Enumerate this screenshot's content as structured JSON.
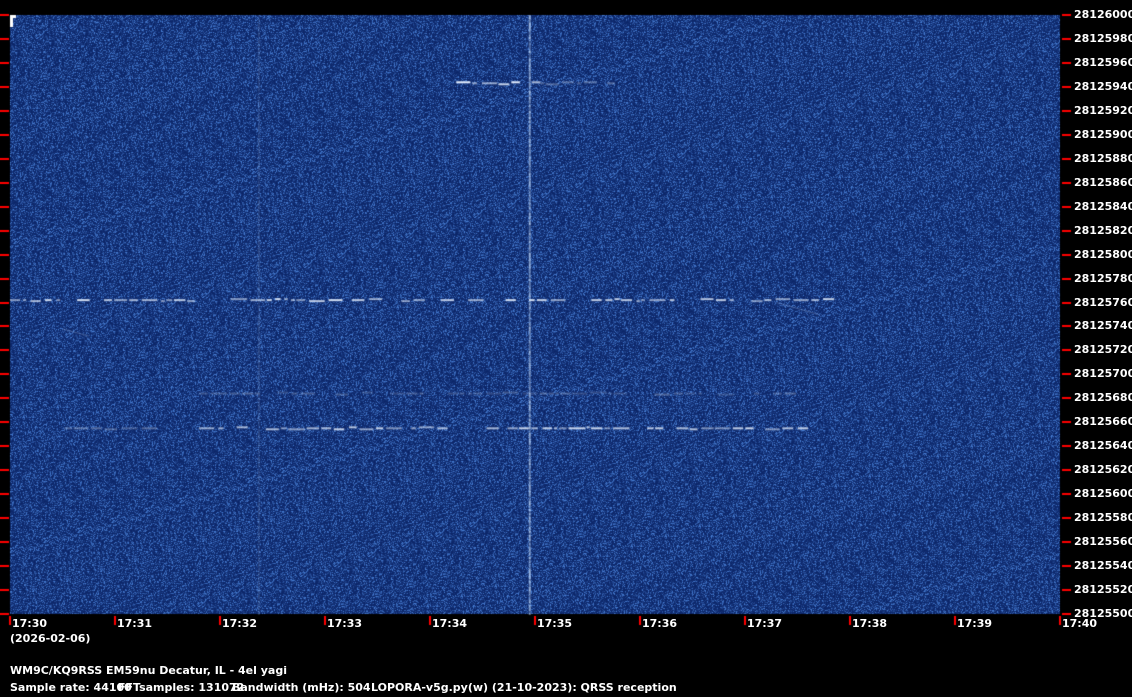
{
  "colors": {
    "background": "#000000",
    "waterfall_base": "#0d2a6e",
    "tick_marks": "#ff0000",
    "signal": "#e6f0ff",
    "text": "#ffffff"
  },
  "chart_data": {
    "type": "heatmap",
    "title": "",
    "xlabel": "",
    "ylabel": "",
    "frequency_axis_hz": {
      "range": [
        28125500,
        28126000
      ],
      "tick_labels": [
        "28126000",
        "28125980",
        "28125960",
        "28125940",
        "28125920",
        "28125900",
        "28125880",
        "28125860",
        "28125840",
        "28125820",
        "28125800",
        "28125780",
        "28125760",
        "28125740",
        "28125720",
        "28125700",
        "28125680",
        "28125660",
        "28125640",
        "28125620",
        "28125600",
        "28125580",
        "28125560",
        "28125540",
        "28125520",
        "28125500"
      ]
    },
    "time_axis": {
      "range_minutes": [
        1050,
        1060
      ],
      "tick_labels": [
        "17:30",
        "17:31",
        "17:32",
        "17:33",
        "17:34",
        "17:35",
        "17:36",
        "17:37",
        "17:38",
        "17:39",
        "17:40"
      ],
      "date": "(2026-02-06)"
    },
    "signals": [
      {
        "kind": "horizontal_trace",
        "freq_hz": 28125762,
        "t_start_min": 1050.0,
        "t_end_min": 1057.85,
        "intensity": 0.9
      },
      {
        "kind": "horizontal_trace",
        "freq_hz": 28125655,
        "t_start_min": 1051.8,
        "t_end_min": 1057.6,
        "intensity": 0.85
      },
      {
        "kind": "horizontal_trace",
        "freq_hz": 28125655,
        "t_start_min": 1050.4,
        "t_end_min": 1051.4,
        "intensity": 0.35
      },
      {
        "kind": "horizontal_trace",
        "freq_hz": 28125684,
        "t_start_min": 1051.8,
        "t_end_min": 1057.5,
        "intensity": 0.3
      },
      {
        "kind": "horizontal_trace",
        "freq_hz": 28125943,
        "t_start_min": 1054.25,
        "t_end_min": 1055.05,
        "intensity": 1.0
      },
      {
        "kind": "horizontal_trace",
        "freq_hz": 28125943,
        "t_start_min": 1055.05,
        "t_end_min": 1055.8,
        "intensity": 0.4
      },
      {
        "kind": "vertical_line",
        "t_min": 1054.95,
        "freq_start_hz": 28125500,
        "freq_end_hz": 28126000,
        "intensity": 0.75
      },
      {
        "kind": "vertical_line",
        "t_min": 1052.37,
        "freq_start_hz": 28125500,
        "freq_end_hz": 28126000,
        "intensity": 0.18
      },
      {
        "kind": "diagonal_trace",
        "t_start_min": 1050.5,
        "t_end_min": 1050.75,
        "freq_start_hz": 28125738,
        "freq_end_hz": 28125732,
        "intensity": 0.3
      },
      {
        "kind": "diagonal_trace",
        "t_start_min": 1057.3,
        "t_end_min": 1057.7,
        "freq_start_hz": 28125760,
        "freq_end_hz": 28125750,
        "intensity": 0.3
      }
    ]
  },
  "footer": {
    "station": "WM9C/KQ9RSS EM59nu Decatur, IL - 4el yagi",
    "sample_rate": "Sample rate: 44100",
    "fft_samples": "FFTsamples: 131072",
    "bandwidth": "Bandwidth (mHz): 504",
    "software": "LOPORA-v5g.py(w) (21-10-2023): QRSS reception"
  }
}
